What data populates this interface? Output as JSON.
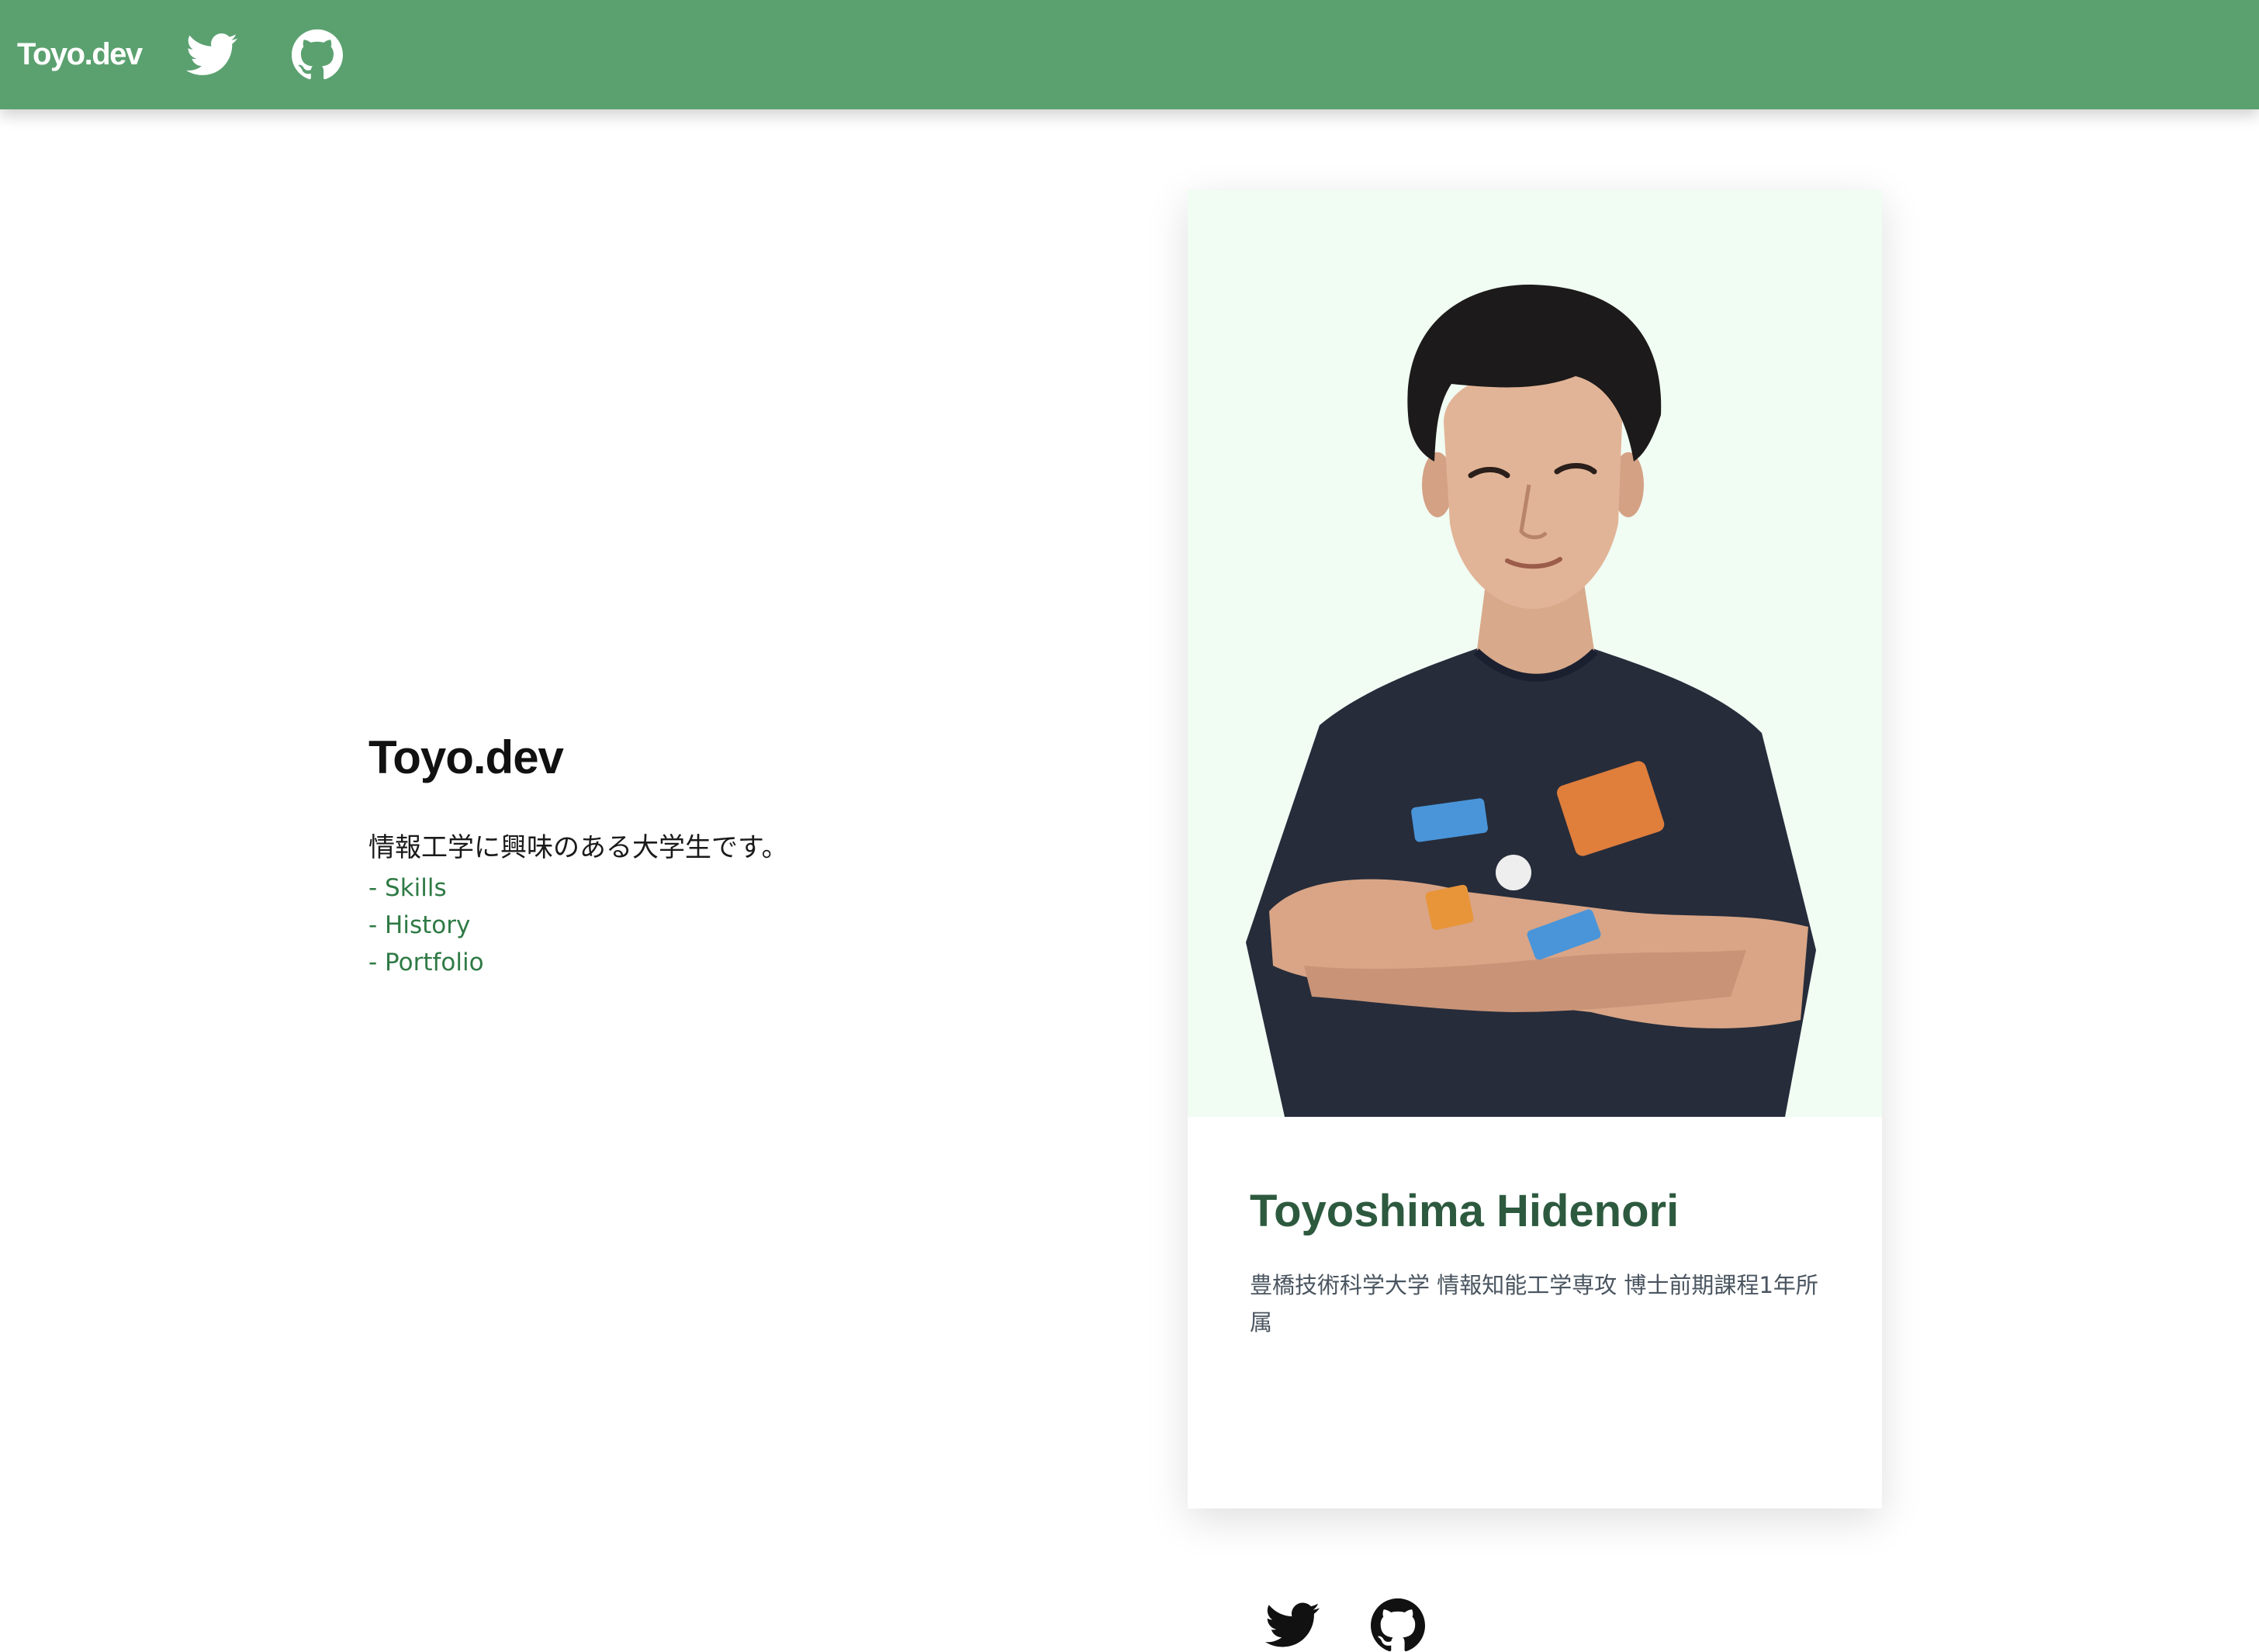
{
  "header": {
    "brand": "Toyo.dev",
    "icons": [
      "twitter-icon",
      "github-icon"
    ],
    "background": "#5ba170"
  },
  "hero": {
    "title": "Toyo.dev",
    "description": "情報工学に興味のある大学生です。",
    "links": [
      "- Skills",
      "- History",
      "- Portfolio"
    ],
    "link_color": "#2f7a45"
  },
  "profile_card": {
    "name": "Toyoshima Hidenori",
    "affiliation": "豊橋技術科学大学 情報知能工学専攻 博士前期課程1年所属",
    "photo_background": "#f1fcf3",
    "icons": [
      "twitter-icon",
      "github-icon"
    ]
  }
}
